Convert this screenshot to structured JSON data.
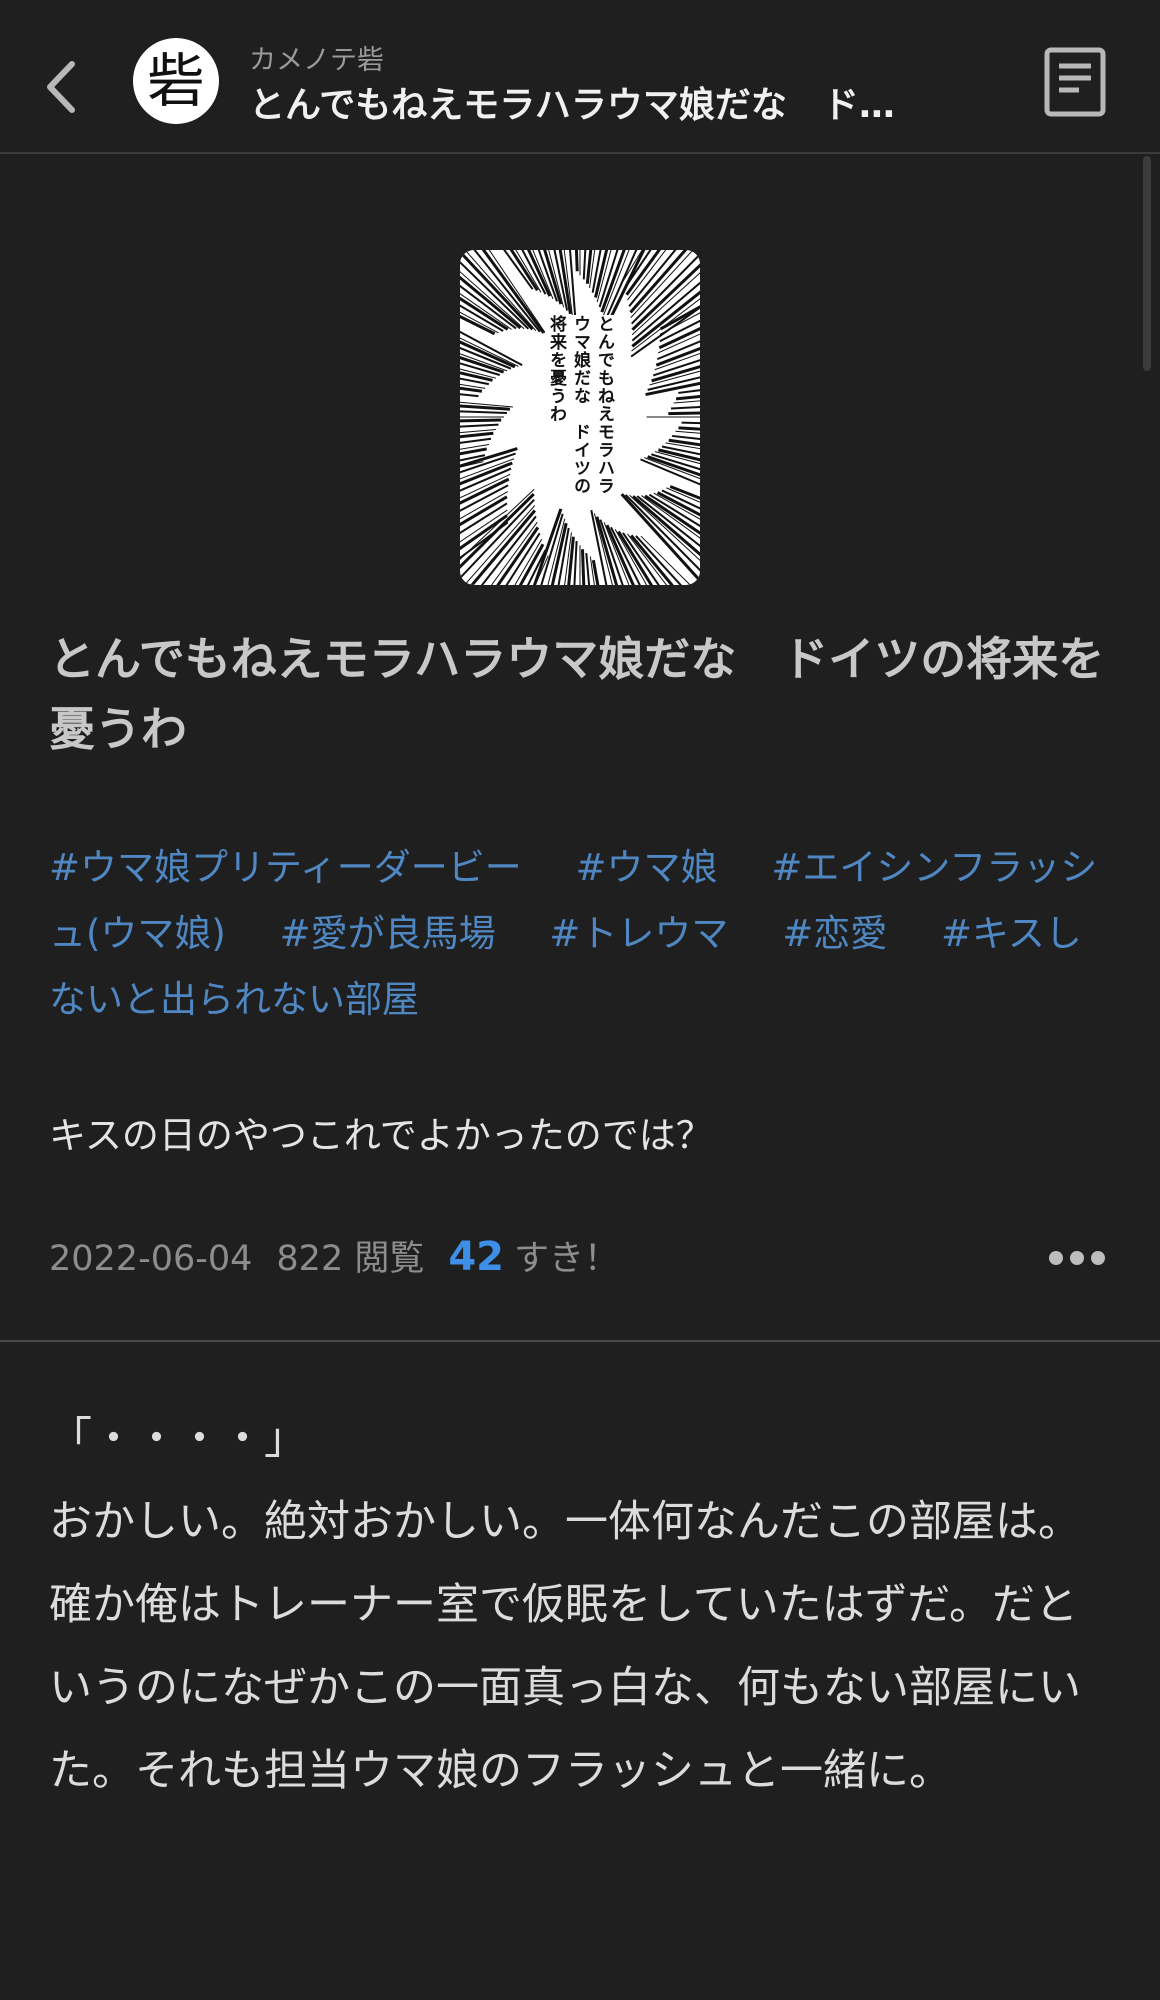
{
  "header": {
    "author": "カメノテ砦",
    "avatar_char": "砦",
    "title": "とんでもねえモラハラウマ娘だな　ド…",
    "back_icon": "chevron-left-icon",
    "toc_icon": "document-list-icon"
  },
  "cover": {
    "lines": [
      "とんでもねえモラハラ",
      "ウマ娘だな　ドイツの",
      "将来を憂うわ"
    ]
  },
  "title": "とんでもねえモラハラウマ娘だな　ドイツの将来を憂うわ",
  "tags": [
    "#ウマ娘プリティーダービー",
    "#ウマ娘",
    "#エイシンフラッシュ(ウマ娘)",
    "#愛が良馬場",
    "#トレウマ",
    "#恋愛",
    "#キスしないと出られない部屋"
  ],
  "caption": "キスの日のやつこれでよかったのでは？",
  "meta": {
    "date": "2022-06-04",
    "views": "822 閲覧",
    "likes": "42",
    "likes_label": "すき！"
  },
  "body": [
    "「・・・・」",
    "おかしい。絶対おかしい。一体何なんだこの部屋は。",
    "確か俺はトレーナー室で仮眠をしていたはずだ。だというのになぜかこの一面真っ白な、何もない部屋にいた。それも担当ウマ娘のフラッシュと一緒に。"
  ],
  "colors": {
    "background": "#1f1f1f",
    "tag": "#4f87c2",
    "likes": "#3d8fe8"
  }
}
